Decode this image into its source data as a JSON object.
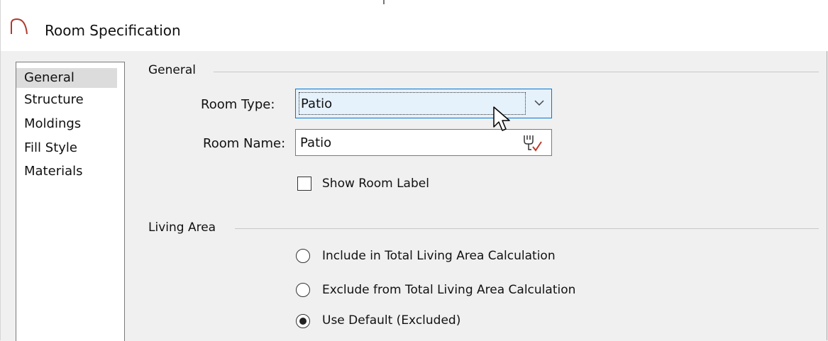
{
  "window": {
    "title": "Room Specification",
    "icon": "arch-icon"
  },
  "nav": {
    "items": [
      {
        "label": "General",
        "selected": true
      },
      {
        "label": "Structure",
        "selected": false
      },
      {
        "label": "Moldings",
        "selected": false
      },
      {
        "label": "Fill Style",
        "selected": false
      },
      {
        "label": "Materials",
        "selected": false
      }
    ]
  },
  "general_group": {
    "heading": "General",
    "room_type": {
      "label": "Room Type:",
      "value": "Patio"
    },
    "room_name": {
      "label": "Room Name:",
      "value": "Patio"
    },
    "show_room_label": {
      "label": "Show Room Label",
      "checked": false
    }
  },
  "living_area_group": {
    "heading": "Living Area",
    "options": [
      {
        "label": "Include in Total Living Area Calculation",
        "selected": false
      },
      {
        "label": "Exclude from Total Living Area Calculation",
        "selected": false
      },
      {
        "label": "Use Default (Excluded)",
        "selected": true
      }
    ]
  },
  "colors": {
    "dialog_bg": "#f0f0f0",
    "accent": "#0078d7",
    "combo_hover_bg": "#e5f1fb",
    "checkmark_red": "#c0392b"
  }
}
